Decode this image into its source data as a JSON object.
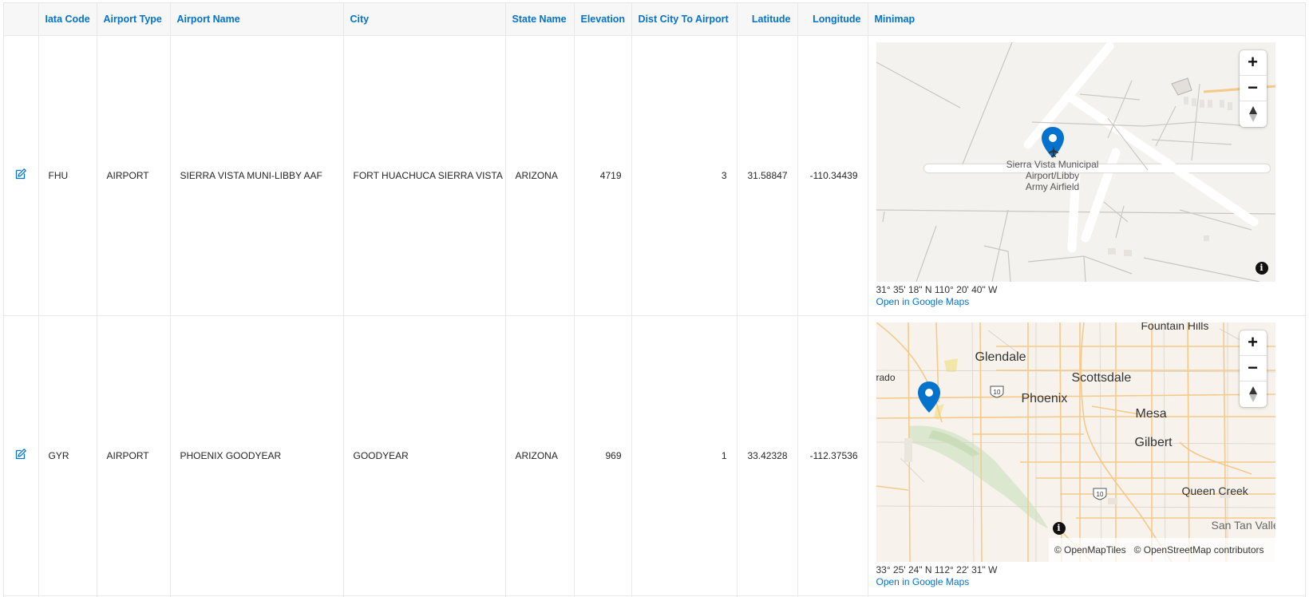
{
  "columns": {
    "iata_code": "Iata Code",
    "airport_type": "Airport Type",
    "airport_name": "Airport Name",
    "city": "City",
    "state_name": "State Name",
    "elevation": "Elevation",
    "dist_city_to_airport": "Dist City To Airport",
    "latitude": "Latitude",
    "longitude": "Longitude",
    "minimap": "Minimap"
  },
  "rows": [
    {
      "iata_code": "FHU",
      "airport_type": "AIRPORT",
      "airport_name": "SIERRA VISTA MUNI-LIBBY AAF",
      "city": "FORT HUACHUCA SIERRA VISTA",
      "state_name": "ARIZONA",
      "elevation": "4719",
      "dist_city_to_airport": "3",
      "latitude": "31.58847",
      "longitude": "-110.34439",
      "map": {
        "label_line1": "Sierra Vista Municipal",
        "label_line2": "Airport/Libby",
        "label_line3": "Army Airfield",
        "coordinates": "31° 35' 18\" N 110° 20' 40\" W",
        "link_text": "Open in Google Maps"
      }
    },
    {
      "iata_code": "GYR",
      "airport_type": "AIRPORT",
      "airport_name": "PHOENIX GOODYEAR",
      "city": "GOODYEAR",
      "state_name": "ARIZONA",
      "elevation": "969",
      "dist_city_to_airport": "1",
      "latitude": "33.42328",
      "longitude": "-112.37536",
      "map": {
        "places": {
          "fountain_hills": "Fountain Hills",
          "glendale": "Glendale",
          "rado": "rado",
          "scottsdale": "Scottsdale",
          "phoenix": "Phoenix",
          "mesa": "Mesa",
          "gilbert": "Gilbert",
          "queen_creek": "Queen Creek",
          "san_tan_valley": "San Tan Valle"
        },
        "highway_shields": [
          "10",
          "10"
        ],
        "attribution_1": "© OpenMapTiles",
        "attribution_2": "© OpenStreetMap contributors",
        "coordinates": "33° 25' 24\" N 112° 22' 31\" W",
        "link_text": "Open in Google Maps"
      }
    }
  ],
  "map_controls": {
    "zoom_in": "+",
    "zoom_out": "−",
    "info": "i"
  },
  "colors": {
    "accent": "#0572ce",
    "marker": "#0572ce",
    "map_bg_1": "#f4f2ee",
    "map_bg_2": "#f7f3ec",
    "road_major": "#f5c98a"
  },
  "icons": {
    "edit": "edit-icon",
    "marker": "map-marker-icon",
    "compass": "compass-icon",
    "info": "info-icon"
  }
}
